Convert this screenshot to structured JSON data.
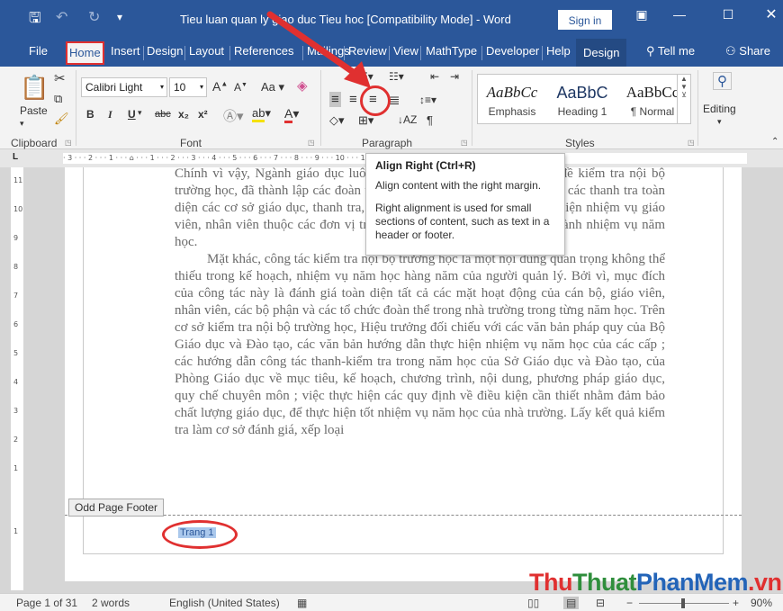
{
  "window": {
    "title": "Tieu luan quan ly giao duc Tieu hoc [Compatibility Mode] - Word",
    "signin_label": "Sign in"
  },
  "tabs": [
    "File",
    "Home",
    "Insert",
    "Design",
    "Layout",
    "References",
    "Mailings",
    "Review",
    "View",
    "MathType",
    "Developer",
    "Help",
    "Design"
  ],
  "tell_me": "Tell me",
  "share": "Share",
  "ribbon": {
    "clipboard": {
      "paste": "Paste",
      "label": "Clipboard"
    },
    "font": {
      "name": "Calibri Light",
      "size": "10",
      "label": "Font",
      "case": "Aa",
      "bold": "B",
      "italic": "I",
      "underline": "U",
      "strike": "abc",
      "sub": "x₂",
      "sup": "x²",
      "grow": "A",
      "shrink": "A"
    },
    "paragraph": {
      "label": "Paragraph"
    },
    "styles": {
      "label": "Styles",
      "items": [
        {
          "preview": "AaBbCc",
          "name": "Emphasis"
        },
        {
          "preview": "AaBbC",
          "name": "Heading 1"
        },
        {
          "preview": "AaBbCc",
          "name": "¶ Normal"
        }
      ]
    },
    "editing": {
      "label": "Editing"
    }
  },
  "tooltip": {
    "title": "Align Right (Ctrl+R)",
    "line1": "Align content with the right margin.",
    "line2": "Right alignment is used for small sections of content, such as text in a header or footer."
  },
  "ruler": "· 3 · · · 2 · · · 1 · · · ⌂ · · · 1 · · · 2 · · · 3 · · · 4 · · · 5 · · · 6 · · · 7 · · · 8 · · · 9 · · · 10 · · · 11 · · · 12 · · · 13 · · · 14 · · · 15 · · · 16 · · · 17 · · · 18",
  "document": {
    "paragraphs": [
      {
        "indent": false,
        "text": "Chính vì vậy, Ngành giáo dục luôn luôn quan tâm và coi trọng vấn đề kiểm tra nội bộ trường học, đã thành lập các đoàn thanh tra về dưới cơ sở để thực hiện các thanh tra toàn diện các cơ sở giáo dục, thanh tra, kiểm tra, giáo, đánh giá việc thực hiện nhiệm vụ giáo viên, nhân viên thuộc các đơn vị trường học nhằm giúp đỡ họ hoàn thành nhiệm vụ năm học."
      },
      {
        "indent": true,
        "text": "Mặt khác, công tác kiểm tra nội bộ trường học là một nội dung quan trọng không thể thiếu trong kế hoạch, nhiệm vụ năm học hàng năm của người quản lý. Bởi vì, mục đích của công tác này là đánh giá toàn diện tất cả các mặt hoạt động của cán bộ, giáo viên, nhân viên, các bộ phận và các tổ chức đoàn thể trong nhà trường trong từng năm học. Trên cơ sở kiểm tra nội bộ trường học, Hiệu trưởng đối chiếu với các văn bản pháp quy của Bộ Giáo dục và Đào tạo, các văn bản hướng dẫn thực hiện nhiệm vụ năm học của các cấp ; các hướng dẫn công tác thanh-kiểm tra trong năm học của Sở Giáo dục và Đào tạo, của Phòng Giáo dục về mục tiêu, kế hoạch, chương trình, nội dung, phương pháp giáo dục, quy chế chuyên môn ; việc thực hiện các quy định về điều kiện cần thiết nhằm đảm bảo chất lượng giáo dục, để thực hiện tốt nhiệm vụ năm học của nhà trường. Lấy kết quả kiểm tra làm cơ sở đánh giá, xếp loại"
      }
    ],
    "footer_tag": "Odd Page Footer",
    "page_field": "Trang 1"
  },
  "status": {
    "page": "Page 1 of 31",
    "words": "2 words",
    "language": "English (United States)",
    "zoom": "90%",
    "zoom_minus": "−",
    "zoom_plus": "+"
  },
  "watermark": {
    "a": "Thu",
    "b": "Thuat",
    "c": "PhanMem",
    "d": ".vn"
  },
  "colors": {
    "brand": "#2b579a",
    "annotation": "#e03030"
  }
}
